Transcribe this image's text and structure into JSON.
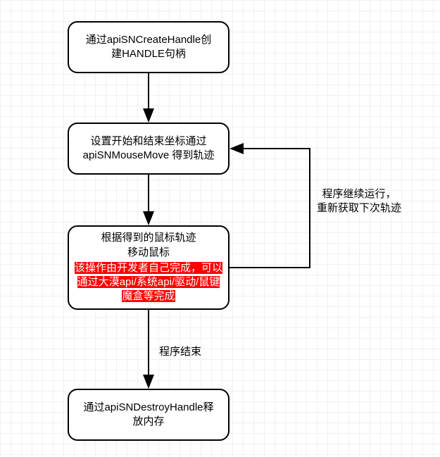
{
  "nodes": {
    "n1": {
      "line1": "通过apiSNCreateHandle创",
      "line2": "建HANDLE句柄"
    },
    "n2": {
      "line1": "设置开始和结束坐标通过",
      "line2": "apiSNMouseMove 得到轨迹"
    },
    "n3": {
      "line1": "根据得到的鼠标轨迹",
      "line2": "移动鼠标",
      "hl1": "该操作由开发者自己完成，可以",
      "hl2": "通过大漠api/系统api/驱动/鼠键",
      "hl3": "魔盒等完成"
    },
    "n4": {
      "line1": "通过apiSNDestroyHandle释",
      "line2": "放内存"
    }
  },
  "edges": {
    "loop": {
      "line1": "程序继续运行，",
      "line2": "重新获取下次轨迹"
    },
    "end": {
      "label": "程序结束"
    }
  }
}
